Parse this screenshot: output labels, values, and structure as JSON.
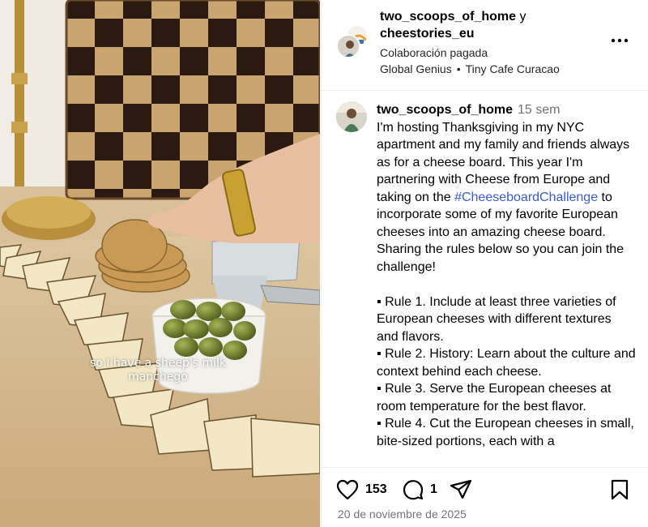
{
  "media": {
    "overlay_caption": "so I have a sheep's milk manchego"
  },
  "header": {
    "user_one": "two_scoops_of_home",
    "joiner": " y",
    "user_two": "cheestories_eu",
    "subtitle": "Colaboración pagada",
    "meta_left": "Global Genius",
    "meta_sep": "•",
    "meta_right": "Tiny Cafe Curacao",
    "more_icon": "more-horizontal-icon"
  },
  "comment": {
    "username": "two_scoops_of_home",
    "time": "15 sem",
    "text_before": "I'm hosting Thanksgiving in my NYC apartment and my family and friends always as for a cheese board. This year I'm partnering with Cheese from Europe and taking on the ",
    "hashtag": "#CheeseboardChallenge",
    "text_after": " to incorporate some of my favorite European cheeses into an amazing cheese board. Sharing the rules below so you can join the challenge!",
    "rules": [
      "▪ Rule 1. Include at least three varieties of European cheeses with different textures and flavors.",
      "▪ Rule 2. History: Learn about the culture and context behind each cheese.",
      "▪ Rule 3. Serve the European cheeses at room temperature for the best flavor.",
      "▪ Rule 4. Cut the European cheeses in small, bite-sized portions, each with a"
    ],
    "hashtag_color": "#385bd6"
  },
  "actions": {
    "like_count": "153",
    "comment_count": "1",
    "icons": [
      "heart-icon",
      "comment-icon",
      "share-icon",
      "bookmark-icon"
    ]
  },
  "date": "20 de noviembre de 2025"
}
